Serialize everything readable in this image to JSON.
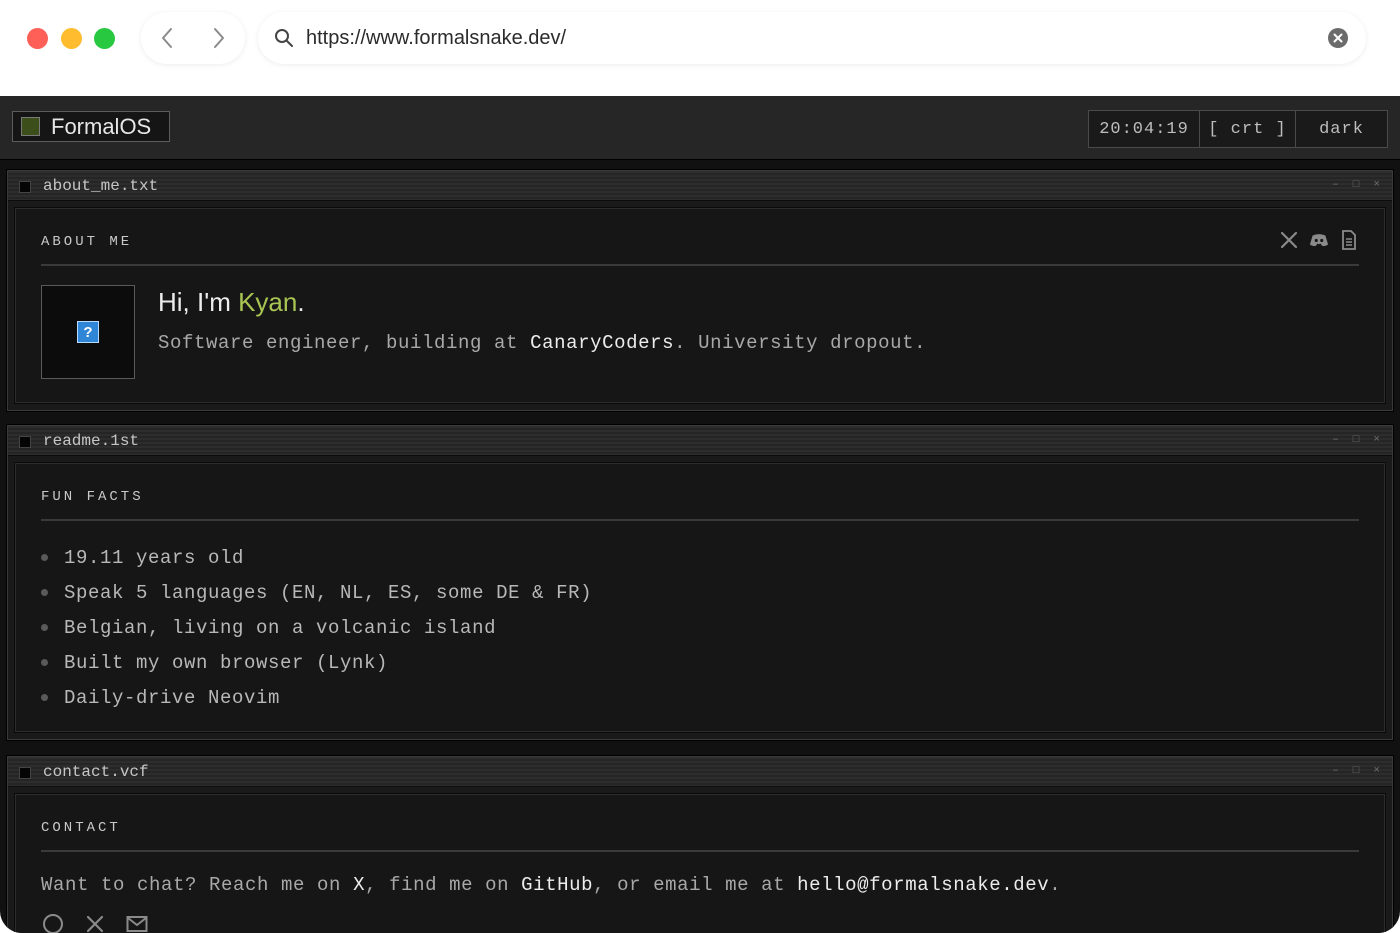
{
  "browser": {
    "url": "https://www.formalsnake.dev/"
  },
  "topbar": {
    "brand": "FormalOS",
    "clock": "20:04:19",
    "crt_label": "[ crt ]",
    "theme_label": "dark"
  },
  "windows": {
    "about": {
      "title": "about_me.txt",
      "heading": "ABOUT ME",
      "greeting_prefix": "Hi, I'm ",
      "name": "Kyan",
      "greeting_suffix": ".",
      "bio_prefix": "Software engineer, building at ",
      "company": "CanaryCoders",
      "bio_suffix": ". University dropout."
    },
    "readme": {
      "title": "readme.1st",
      "heading": "FUN FACTS",
      "facts": [
        "19.11 years old",
        "Speak 5 languages (EN, NL, ES, some DE & FR)",
        "Belgian, living on a volcanic island",
        "Built my own browser (Lynk)",
        "Daily-drive Neovim"
      ]
    },
    "contact": {
      "title": "contact.vcf",
      "heading": "CONTACT",
      "line_1": "Want to chat? Reach me on ",
      "link_x": "X",
      "line_2": ", find me on ",
      "link_github": "GitHub",
      "line_3": ", or email me at ",
      "email": "hello@formalsnake.dev",
      "line_4": "."
    }
  },
  "window_controls": {
    "minimize": "–",
    "maximize": "□",
    "close": "×"
  },
  "icons": {
    "accent_name_color": "#a8c452",
    "help_icon_glyph": "?"
  }
}
